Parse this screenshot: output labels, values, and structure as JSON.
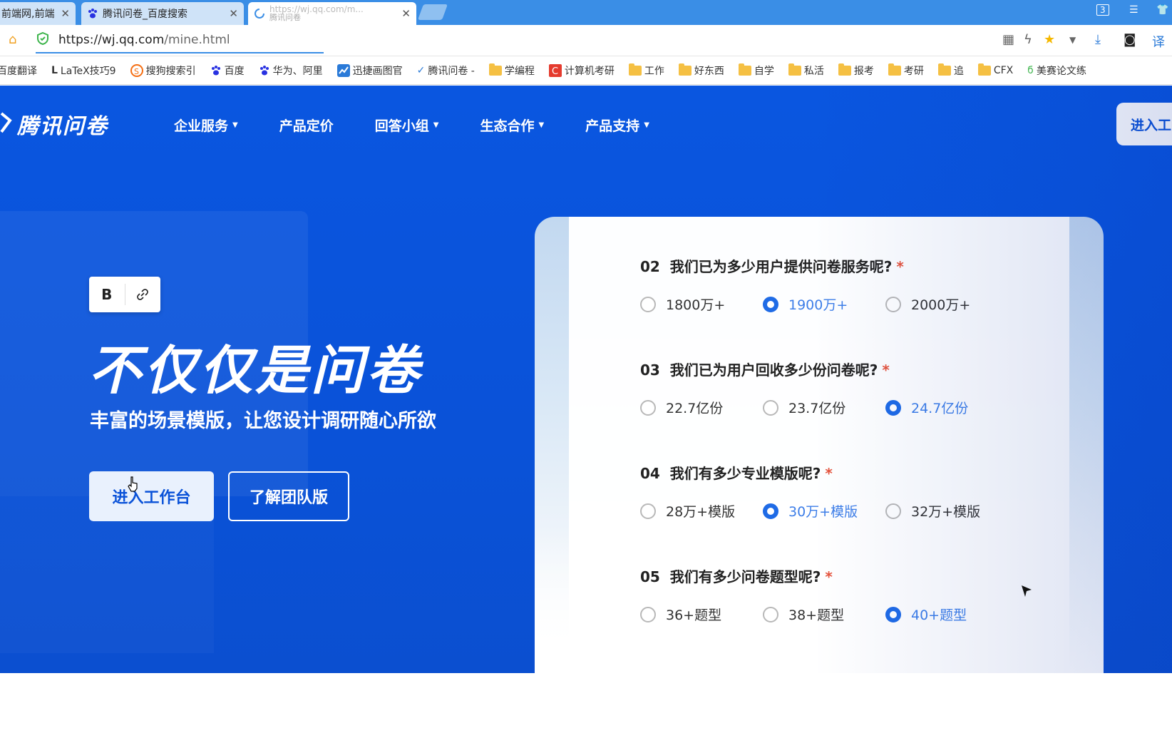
{
  "tabs": [
    {
      "title": "前端网,前端资",
      "active": false
    },
    {
      "title": "腾讯问卷_百度搜索",
      "active": false
    },
    {
      "title": "https://wj.qq.com/m...",
      "subtitle": "腾讯问卷",
      "active": true
    }
  ],
  "window": {
    "tab_count": "3"
  },
  "address": {
    "scheme_host": "https://wj.qq.com",
    "path": "/mine.html"
  },
  "bookmarks": [
    {
      "label": "百度翻译",
      "icon": "none"
    },
    {
      "label": "LaTeX技巧9",
      "icon": "latex-icon"
    },
    {
      "label": "搜狗搜索引",
      "icon": "sogou-icon"
    },
    {
      "label": "百度",
      "icon": "baidu-paw-icon"
    },
    {
      "label": "华为、阿里",
      "icon": "baidu-paw-icon"
    },
    {
      "label": "迅捷画图官",
      "icon": "chart-icon"
    },
    {
      "label": "腾讯问卷 -",
      "icon": "check-icon"
    },
    {
      "label": "学编程",
      "icon": "folder-icon"
    },
    {
      "label": "计算机考研",
      "icon": "c-icon"
    },
    {
      "label": "工作",
      "icon": "folder-icon"
    },
    {
      "label": "好东西",
      "icon": "folder-icon"
    },
    {
      "label": "自学",
      "icon": "folder-icon"
    },
    {
      "label": "私活",
      "icon": "folder-icon"
    },
    {
      "label": "报考",
      "icon": "folder-icon"
    },
    {
      "label": "考研",
      "icon": "folder-icon"
    },
    {
      "label": "追",
      "icon": "folder-icon"
    },
    {
      "label": "CFX",
      "icon": "folder-icon"
    },
    {
      "label": "美赛论文练",
      "icon": "leaf-icon"
    }
  ],
  "site": {
    "logo_text": "腾讯问卷",
    "nav": [
      {
        "label": "企业服务",
        "has_caret": true
      },
      {
        "label": "产品定价",
        "has_caret": false
      },
      {
        "label": "回答小组",
        "has_caret": true
      },
      {
        "label": "生态合作",
        "has_caret": true
      },
      {
        "label": "产品支持",
        "has_caret": true
      }
    ],
    "enter_top": "进入工"
  },
  "editor_toolbar": {
    "bold": "B"
  },
  "hero": {
    "title": "不仅仅是问卷",
    "subtitle": "丰富的场景模版，让您设计调研随心所欲",
    "primary_btn": "进入工作台",
    "secondary_btn": "了解团队版"
  },
  "survey": {
    "questions": [
      {
        "num": "02",
        "text": "我们已为多少用户提供问卷服务呢?",
        "required": "*",
        "options": [
          "1800万+",
          "1900万+",
          "2000万+"
        ],
        "selected": 1
      },
      {
        "num": "03",
        "text": "我们已为用户回收多少份问卷呢?",
        "required": "*",
        "options": [
          "22.7亿份",
          "23.7亿份",
          "24.7亿份"
        ],
        "selected": 2
      },
      {
        "num": "04",
        "text": "我们有多少专业模版呢?",
        "required": "*",
        "options": [
          "28万+模版",
          "30万+模版",
          "32万+模版"
        ],
        "selected": 1
      },
      {
        "num": "05",
        "text": "我们有多少问卷题型呢?",
        "required": "*",
        "options": [
          "36+题型",
          "38+题型",
          "40+题型"
        ],
        "selected": 2
      }
    ]
  },
  "colors": {
    "brand_blue": "#0a52d8",
    "tab_bar": "#3a8ee6",
    "radio_selected": "#1f6be6",
    "required": "#e5533c"
  }
}
